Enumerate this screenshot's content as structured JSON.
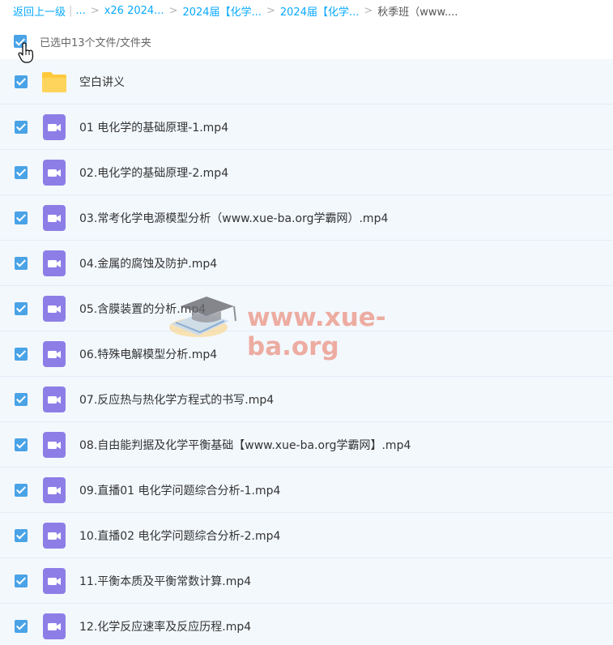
{
  "breadcrumb": {
    "back": "返回上一级",
    "ellipsis": "...",
    "items": [
      "x26 2024...",
      "2024届【化学...",
      "2024届【化学..."
    ],
    "current": "秋季班（www...."
  },
  "selection": {
    "text": "已选中13个文件/文件夹",
    "all_checked": true
  },
  "files": [
    {
      "name": "空白讲义",
      "type": "folder",
      "checked": true
    },
    {
      "name": "01 电化学的基础原理-1.mp4",
      "type": "video",
      "checked": true
    },
    {
      "name": "02.电化学的基础原理-2.mp4",
      "type": "video",
      "checked": true
    },
    {
      "name": "03.常考化学电源模型分析（www.xue-ba.org学霸网）.mp4",
      "type": "video",
      "checked": true
    },
    {
      "name": "04.金属的腐蚀及防护.mp4",
      "type": "video",
      "checked": true
    },
    {
      "name": "05.含膜装置的分析.mp4",
      "type": "video",
      "checked": true
    },
    {
      "name": "06.特殊电解模型分析.mp4",
      "type": "video",
      "checked": true
    },
    {
      "name": "07.反应热与热化学方程式的书写.mp4",
      "type": "video",
      "checked": true
    },
    {
      "name": "08.自由能判据及化学平衡基础【www.xue-ba.org学霸网】.mp4",
      "type": "video",
      "checked": true
    },
    {
      "name": "09.直播01 电化学问题综合分析-1.mp4",
      "type": "video",
      "checked": true
    },
    {
      "name": "10.直播02 电化学问题综合分析-2.mp4",
      "type": "video",
      "checked": true
    },
    {
      "name": "11.平衡本质及平衡常数计算.mp4",
      "type": "video",
      "checked": true
    },
    {
      "name": "12.化学反应速率及反应历程.mp4",
      "type": "video",
      "checked": true
    }
  ],
  "watermark": {
    "text": "www.xue-ba.org"
  },
  "colors": {
    "link": "#09aaff",
    "checkbox": "#4aa3e6",
    "row_bg": "#f3f8fd",
    "folder": "#ffc93c",
    "video": "#8c7ee6"
  }
}
